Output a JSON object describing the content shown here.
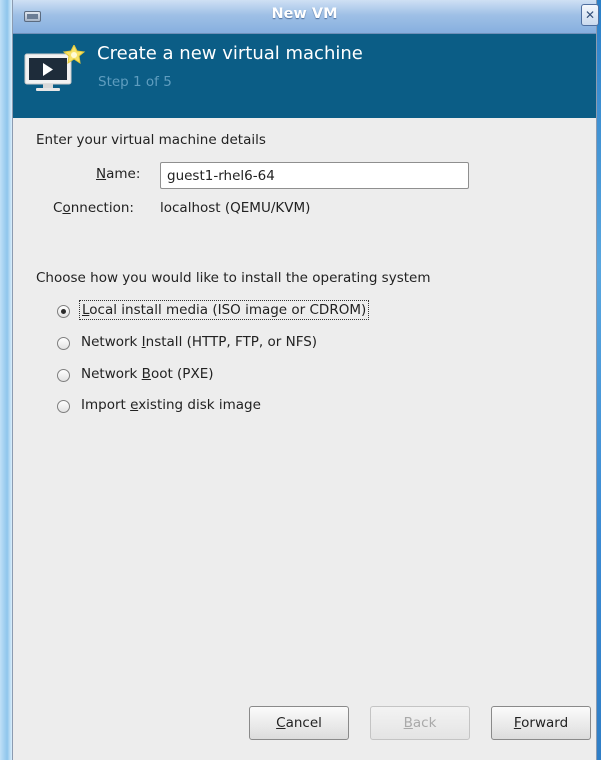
{
  "window": {
    "title": "New VM",
    "close_glyph": "✕"
  },
  "banner": {
    "title": "Create a new virtual machine",
    "step": "Step 1 of 5",
    "icon": "virtual-machine-icon"
  },
  "details": {
    "heading": "Enter your virtual machine details",
    "name_label": {
      "mnemonic": "N",
      "rest": "ame:"
    },
    "name_value": "guest1-rhel6-64",
    "connection_label": {
      "pre": "C",
      "mnemonic": "o",
      "rest": "nnection:"
    },
    "connection_value": "localhost (QEMU/KVM)"
  },
  "install": {
    "heading": "Choose how you would like to install the operating system",
    "options": [
      {
        "pre": "",
        "mnemonic": "L",
        "rest": "ocal install media (ISO image or CDROM)",
        "selected": true
      },
      {
        "pre": "Network ",
        "mnemonic": "I",
        "rest": "nstall (HTTP, FTP, or NFS)",
        "selected": false
      },
      {
        "pre": "Network ",
        "mnemonic": "B",
        "rest": "oot (PXE)",
        "selected": false
      },
      {
        "pre": "Import ",
        "mnemonic": "e",
        "rest": "xisting disk image",
        "selected": false
      }
    ]
  },
  "buttons": {
    "cancel": {
      "mnemonic": "C",
      "rest": "ancel",
      "enabled": true
    },
    "back": {
      "mnemonic": "B",
      "rest": "ack",
      "enabled": false
    },
    "forward": {
      "mnemonic": "F",
      "rest": "orward",
      "enabled": true
    }
  },
  "colors": {
    "banner": "#0b5d86",
    "step_text": "#5f9dbf",
    "dialog_bg": "#ededed"
  }
}
